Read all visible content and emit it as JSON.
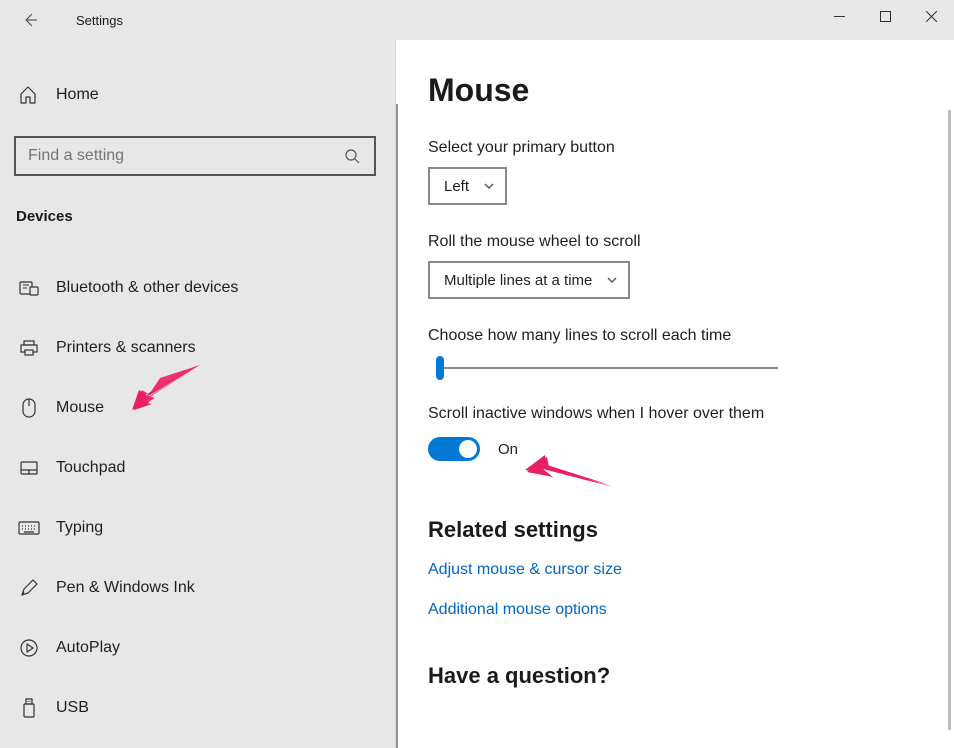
{
  "window": {
    "title": "Settings"
  },
  "sidebar": {
    "home_label": "Home",
    "search_placeholder": "Find a setting",
    "group_header": "Devices",
    "items": [
      {
        "icon": "bluetooth-icon",
        "label": "Bluetooth & other devices"
      },
      {
        "icon": "printer-icon",
        "label": "Printers & scanners"
      },
      {
        "icon": "mouse-icon",
        "label": "Mouse"
      },
      {
        "icon": "touchpad-icon",
        "label": "Touchpad"
      },
      {
        "icon": "keyboard-icon",
        "label": "Typing"
      },
      {
        "icon": "pen-icon",
        "label": "Pen & Windows Ink"
      },
      {
        "icon": "autoplay-icon",
        "label": "AutoPlay"
      },
      {
        "icon": "usb-icon",
        "label": "USB"
      }
    ]
  },
  "main": {
    "page_title": "Mouse",
    "primary_button_label": "Select your primary button",
    "primary_button_value": "Left",
    "wheel_scroll_label": "Roll the mouse wheel to scroll",
    "wheel_scroll_value": "Multiple lines at a time",
    "lines_label": "Choose how many lines to scroll each time",
    "hover_scroll_label": "Scroll inactive windows when I hover over them",
    "hover_scroll_value": "On",
    "related_header": "Related settings",
    "link_adjust": "Adjust mouse & cursor size",
    "link_additional": "Additional mouse options",
    "question_header": "Have a question?"
  },
  "colors": {
    "accent": "#0078d4",
    "link": "#0067c0",
    "annotation": "#e91e63"
  }
}
